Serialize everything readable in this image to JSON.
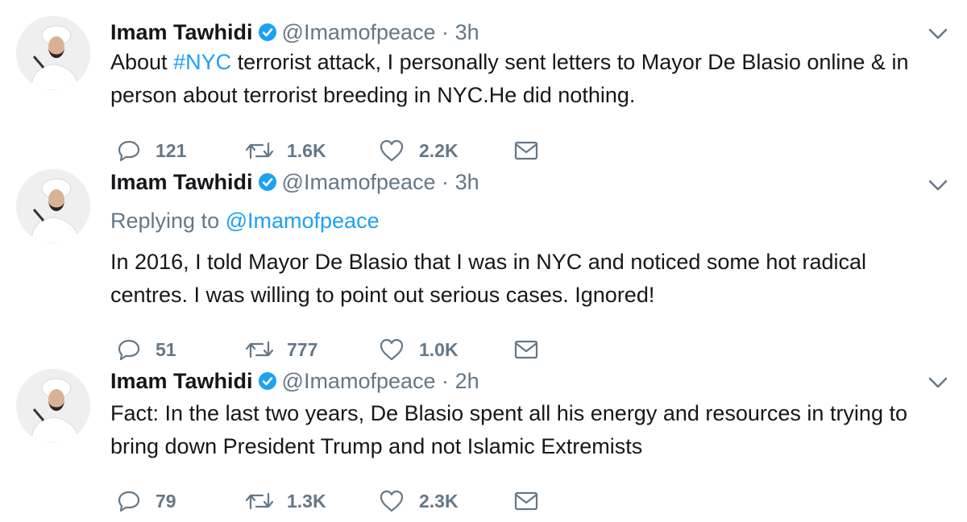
{
  "tweets": [
    {
      "name": "Imam Tawhidi",
      "handle": "@Imamofpeace",
      "separator": "·",
      "time": "3h",
      "text_before": "About ",
      "hashtag": "#NYC",
      "text_after": " terrorist attack, I personally sent letters to Mayor De Blasio online & in person about terrorist breeding in NYC.He did nothing.",
      "replies": "121",
      "retweets": "1.6K",
      "likes": "2.2K"
    },
    {
      "name": "Imam Tawhidi",
      "handle": "@Imamofpeace",
      "separator": "·",
      "time": "3h",
      "replying_prefix": "Replying to ",
      "replying_handle": "@Imamofpeace",
      "text": "In 2016, I told Mayor De Blasio that I was in NYC and noticed some hot radical centres. I was willing to point out serious cases. Ignored!",
      "replies": "51",
      "retweets": "777",
      "likes": "1.0K"
    },
    {
      "name": "Imam Tawhidi",
      "handle": "@Imamofpeace",
      "separator": "·",
      "time": "2h",
      "text": "Fact: In the last two years, De Blasio spent all his energy and resources in trying to bring down President Trump and not Islamic Extremists",
      "replies": "79",
      "retweets": "1.3K",
      "likes": "2.3K"
    }
  ],
  "icons": {
    "reply": "reply-icon",
    "retweet": "retweet-icon",
    "like": "heart-icon",
    "dm": "envelope-icon",
    "verified": "verified-badge-icon",
    "caret": "chevron-down-icon"
  },
  "colors": {
    "link": "#1da1f2",
    "muted": "#657786",
    "text": "#14171a"
  }
}
